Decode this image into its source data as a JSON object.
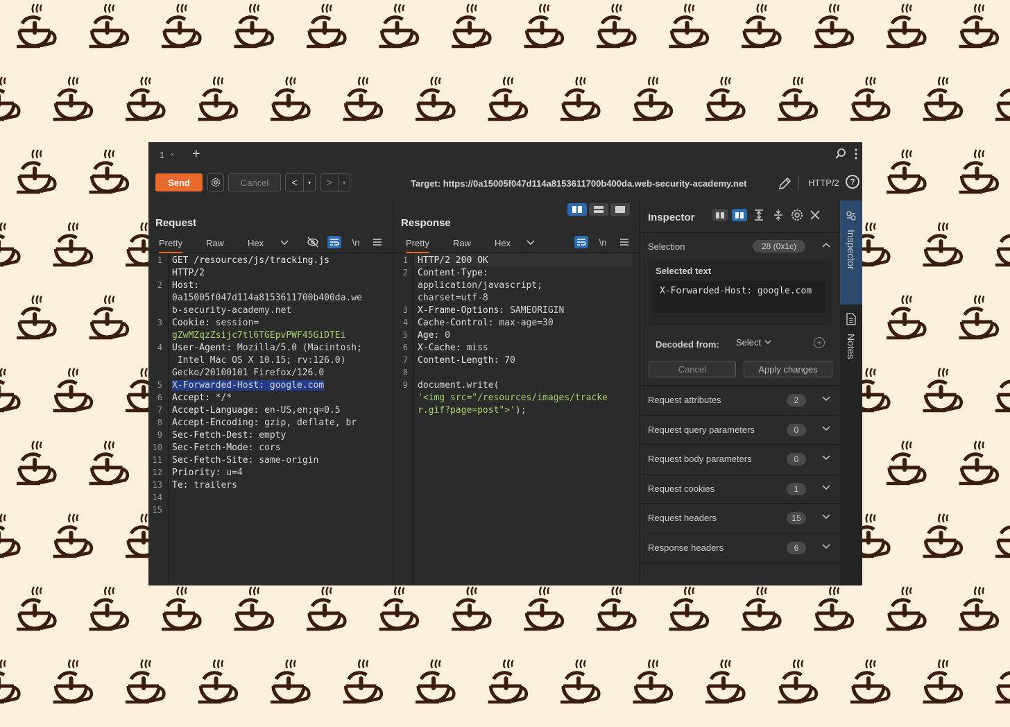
{
  "tabs": {
    "tab_label": "1",
    "close": "×",
    "add": "+"
  },
  "toolbar": {
    "send": "Send",
    "cancel": "Cancel",
    "back": "<",
    "forward": ">",
    "dropdown": "▾",
    "target": "Target: https://0a15005f047d114a8153611700b400da.web-security-academy.net",
    "protocol": "HTTP/2",
    "help": "?"
  },
  "request": {
    "title": "Request",
    "tabs": [
      "Pretty",
      "Raw",
      "Hex"
    ],
    "newline_label": "\\n",
    "lines": [
      {
        "n": "1",
        "segs": [
          {
            "t": "GET /resources/js/tracking.js",
            "c": "k"
          }
        ]
      },
      {
        "n": "",
        "segs": [
          {
            "t": "HTTP/2",
            "c": "k"
          }
        ]
      },
      {
        "n": "2",
        "segs": [
          {
            "t": "Host:",
            "c": "k"
          }
        ]
      },
      {
        "n": "",
        "segs": [
          {
            "t": "0a15005f047d114a8153611700b400da.we",
            "c": ""
          }
        ]
      },
      {
        "n": "",
        "segs": [
          {
            "t": "b-security-academy.net",
            "c": ""
          }
        ]
      },
      {
        "n": "3",
        "segs": [
          {
            "t": "Cookie: ",
            "c": "k"
          },
          {
            "t": "session=",
            "c": ""
          }
        ]
      },
      {
        "n": "",
        "segs": [
          {
            "t": "gZwMZqzZsijc7tl6TGEpvPWF45GiDTEi",
            "c": "green"
          }
        ]
      },
      {
        "n": "4",
        "segs": [
          {
            "t": "User-Agent: ",
            "c": "k"
          },
          {
            "t": "Mozilla/5.0 (Macintosh;",
            "c": ""
          }
        ]
      },
      {
        "n": "",
        "segs": [
          {
            "t": " Intel Mac OS X 10.15; rv:126.0)",
            "c": ""
          }
        ]
      },
      {
        "n": "",
        "segs": [
          {
            "t": "Gecko/20100101 Firefox/126.0",
            "c": ""
          }
        ]
      },
      {
        "n": "5",
        "segs": [
          {
            "t": "X-Forwarded-Host: google.com",
            "c": "hl"
          }
        ]
      },
      {
        "n": "6",
        "segs": [
          {
            "t": "Accept: ",
            "c": "k"
          },
          {
            "t": "*/*",
            "c": ""
          }
        ]
      },
      {
        "n": "7",
        "segs": [
          {
            "t": "Accept-Language: ",
            "c": "k"
          },
          {
            "t": "en-US,en;q=0.5",
            "c": ""
          }
        ]
      },
      {
        "n": "8",
        "segs": [
          {
            "t": "Accept-Encoding: ",
            "c": "k"
          },
          {
            "t": "gzip, deflate, br",
            "c": ""
          }
        ]
      },
      {
        "n": "9",
        "segs": [
          {
            "t": "Sec-Fetch-Dest: ",
            "c": "k"
          },
          {
            "t": "empty",
            "c": ""
          }
        ]
      },
      {
        "n": "10",
        "segs": [
          {
            "t": "Sec-Fetch-Mode: ",
            "c": "k"
          },
          {
            "t": "cors",
            "c": ""
          }
        ]
      },
      {
        "n": "11",
        "segs": [
          {
            "t": "Sec-Fetch-Site: ",
            "c": "k"
          },
          {
            "t": "same-origin",
            "c": ""
          }
        ]
      },
      {
        "n": "12",
        "segs": [
          {
            "t": "Priority: ",
            "c": "k"
          },
          {
            "t": "u=4",
            "c": ""
          }
        ]
      },
      {
        "n": "13",
        "segs": [
          {
            "t": "Te: ",
            "c": "k"
          },
          {
            "t": "trailers",
            "c": ""
          }
        ]
      },
      {
        "n": "14",
        "segs": []
      },
      {
        "n": "15",
        "segs": []
      }
    ]
  },
  "response": {
    "title": "Response",
    "tabs": [
      "Pretty",
      "Raw",
      "Hex"
    ],
    "newline_label": "\\n",
    "lines": [
      {
        "n": "1",
        "segs": [
          {
            "t": "HTTP/2 200 OK",
            "c": "k"
          }
        ]
      },
      {
        "n": "2",
        "segs": [
          {
            "t": "Content-Type:",
            "c": "k"
          }
        ]
      },
      {
        "n": "",
        "segs": [
          {
            "t": "application/javascript;",
            "c": ""
          }
        ]
      },
      {
        "n": "",
        "segs": [
          {
            "t": "charset=utf-8",
            "c": ""
          }
        ]
      },
      {
        "n": "3",
        "segs": [
          {
            "t": "X-Frame-Options: ",
            "c": "k"
          },
          {
            "t": "SAMEORIGIN",
            "c": ""
          }
        ]
      },
      {
        "n": "4",
        "segs": [
          {
            "t": "Cache-Control: ",
            "c": "k"
          },
          {
            "t": "max-age=30",
            "c": ""
          }
        ]
      },
      {
        "n": "5",
        "segs": [
          {
            "t": "Age: ",
            "c": "k"
          },
          {
            "t": "0",
            "c": ""
          }
        ]
      },
      {
        "n": "6",
        "segs": [
          {
            "t": "X-Cache: ",
            "c": "k"
          },
          {
            "t": "miss",
            "c": ""
          }
        ]
      },
      {
        "n": "7",
        "segs": [
          {
            "t": "Content-Length: ",
            "c": "k"
          },
          {
            "t": "70",
            "c": ""
          }
        ]
      },
      {
        "n": "8",
        "segs": []
      },
      {
        "n": "9",
        "segs": [
          {
            "t": "document.write(",
            "c": ""
          }
        ]
      },
      {
        "n": "",
        "segs": [
          {
            "t": "'<img src=\"/resources/images/tracke",
            "c": "green"
          }
        ]
      },
      {
        "n": "",
        "segs": [
          {
            "t": "r.gif?page=post\">'",
            "c": "green"
          },
          {
            "t": ");",
            "c": ""
          }
        ]
      }
    ]
  },
  "inspector": {
    "title": "Inspector",
    "selection_label": "Selection",
    "selection_count": "28 (0x1c)",
    "selected_text_title": "Selected text",
    "selected_text": "X-Forwarded-Host: google.com",
    "decoded_from_label": "Decoded from:",
    "decoded_from_value": "Select",
    "cancel": "Cancel",
    "apply": "Apply changes",
    "sections": [
      {
        "label": "Request attributes",
        "count": "2"
      },
      {
        "label": "Request query parameters",
        "count": "0"
      },
      {
        "label": "Request body parameters",
        "count": "0"
      },
      {
        "label": "Request cookies",
        "count": "1"
      },
      {
        "label": "Request headers",
        "count": "15"
      },
      {
        "label": "Response headers",
        "count": "6"
      }
    ]
  },
  "sidebar": {
    "inspector": "Inspector",
    "notes": "Notes"
  },
  "colors": {
    "accent": "#e8692e",
    "blue": "#2b6cb0",
    "background": "#fdf0dd",
    "pattern": "#3b1d0d"
  },
  "icons": [
    "search-icon",
    "kebab-menu-icon",
    "gear-icon",
    "pencil-icon",
    "help-icon",
    "eye-off-icon",
    "wrap-icon",
    "hamburger-icon",
    "close-icon",
    "chevron-down-icon",
    "chevron-up-icon",
    "plus-circle-icon",
    "notes-icon",
    "inspector-icon",
    "coffee-cup-icon"
  ]
}
